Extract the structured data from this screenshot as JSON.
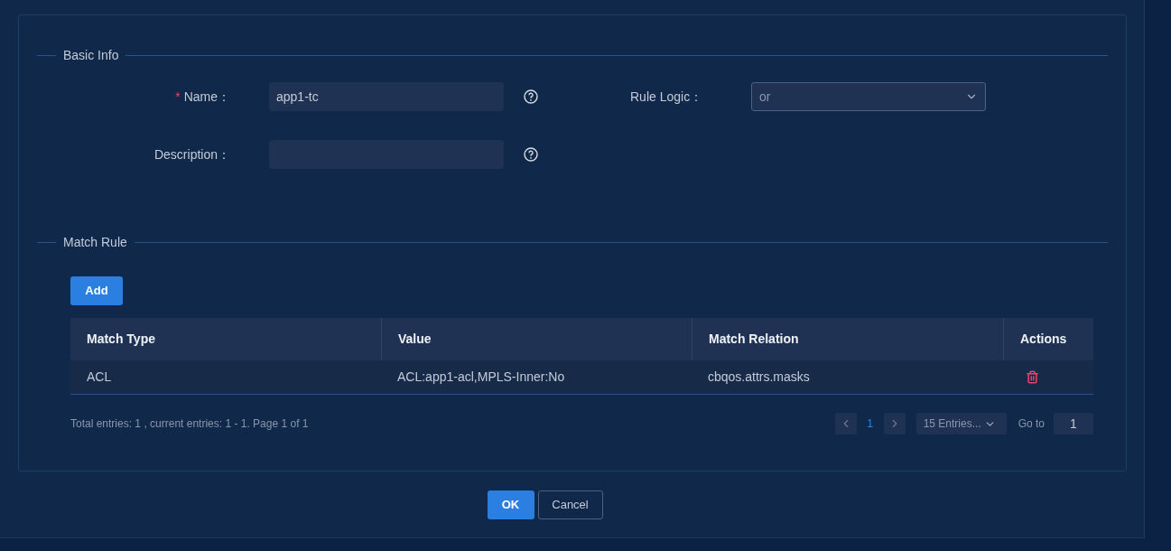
{
  "basic_info": {
    "title": "Basic Info",
    "name": {
      "label": "Name：",
      "required_mark": "*",
      "value": "app1-tc"
    },
    "description": {
      "label": "Description："
    },
    "rule_logic": {
      "label": "Rule Logic：",
      "value": "or"
    }
  },
  "match_rule": {
    "title": "Match Rule",
    "add_button": "Add",
    "table": {
      "columns": [
        "Match Type",
        "Value",
        "Match Relation",
        "Actions"
      ],
      "rows": [
        {
          "match_type": "ACL",
          "value": "ACL:app1-acl,MPLS-Inner:No",
          "match_relation": "cbqos.attrs.masks"
        }
      ]
    },
    "pagination": {
      "summary": "Total entries: 1 , current entries: 1 - 1. Page 1 of 1",
      "pages": [
        {
          "label": "1",
          "selected": true
        }
      ],
      "page_size": "15 Entries...",
      "goto_label": "Go to",
      "goto_value": "1"
    }
  },
  "buttons": {
    "ok": "OK",
    "cancel": "Cancel"
  }
}
